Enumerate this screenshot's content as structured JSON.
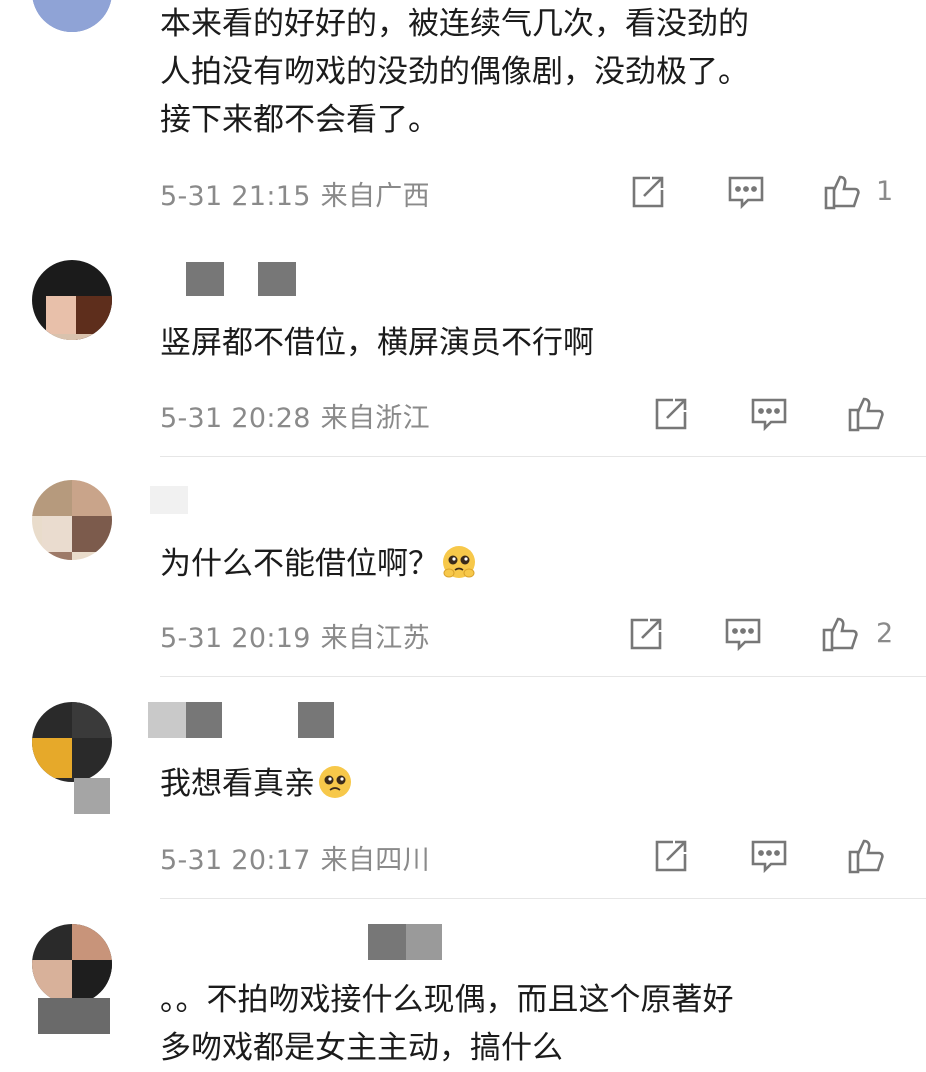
{
  "comments": [
    {
      "text_lines": [
        "本来看的好好的，被连续气几次，看没劲的",
        "人拍没有吻戏的没劲的偶像剧，没劲极了。",
        "接下来都不会看了。"
      ],
      "date": "5-31 21:15",
      "location": "来自广西",
      "likes": "1"
    },
    {
      "text_lines": [
        "竖屏都不借位，横屏演员不行啊"
      ],
      "date": "5-31 20:28",
      "location": "来自浙江",
      "likes": ""
    },
    {
      "text_lines": [
        "为什么不能借位啊？"
      ],
      "emoji": "pleading-face-emoji",
      "date": "5-31 20:19",
      "location": "来自江苏",
      "likes": "2"
    },
    {
      "text_lines": [
        "我想看真亲"
      ],
      "emoji": "pleading-face-emoji",
      "date": "5-31 20:17",
      "location": "来自四川",
      "likes": ""
    },
    {
      "text_lines": [
        "。。不拍吻戏接什么现偶，而且这个原著好",
        "多吻戏都是女主主动，搞什么"
      ],
      "date": "",
      "location": "",
      "likes": ""
    }
  ],
  "icons": {
    "share": "share-icon",
    "comment": "comment-icon",
    "like": "like-icon"
  },
  "colors": {
    "text": "#1b1b1b",
    "meta": "#8a8a8a",
    "icon": "#777777",
    "divider": "#e6e6e6"
  }
}
